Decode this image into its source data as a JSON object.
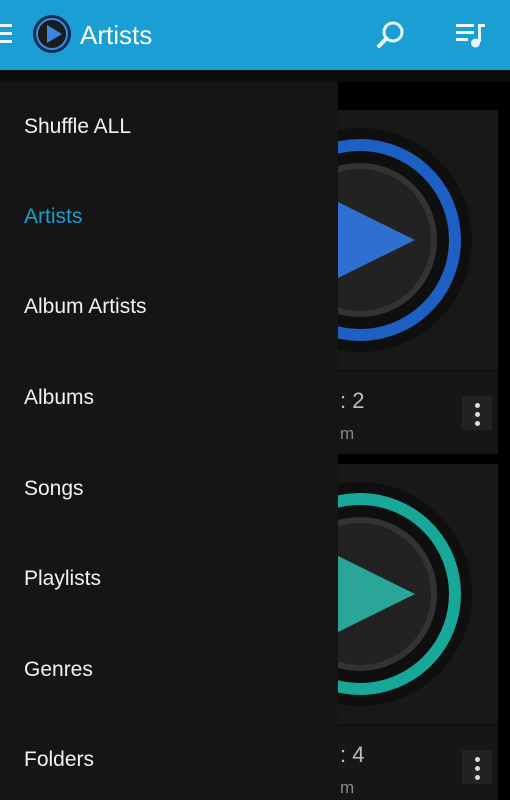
{
  "appbar": {
    "title": "Artists",
    "menu_icon": "hamburger-icon",
    "logo_icon": "play-logo-icon",
    "search_icon": "search-icon",
    "queue_icon": "queue-music-icon",
    "color": "#1a9ed3"
  },
  "drawer": {
    "items": [
      {
        "label": "Shuffle ALL"
      },
      {
        "label": "Artists",
        "active": true
      },
      {
        "label": "Album Artists"
      },
      {
        "label": "Albums"
      },
      {
        "label": "Songs"
      },
      {
        "label": "Playlists"
      },
      {
        "label": "Genres"
      },
      {
        "label": "Folders"
      }
    ],
    "active_color": "#1a9ed3"
  },
  "cards": [
    {
      "line1": ": 2",
      "line2": "m",
      "ring_color": "#1e5fc4"
    },
    {
      "line1": ": 4",
      "line2": "m",
      "ring_color": "#17a89a"
    }
  ]
}
